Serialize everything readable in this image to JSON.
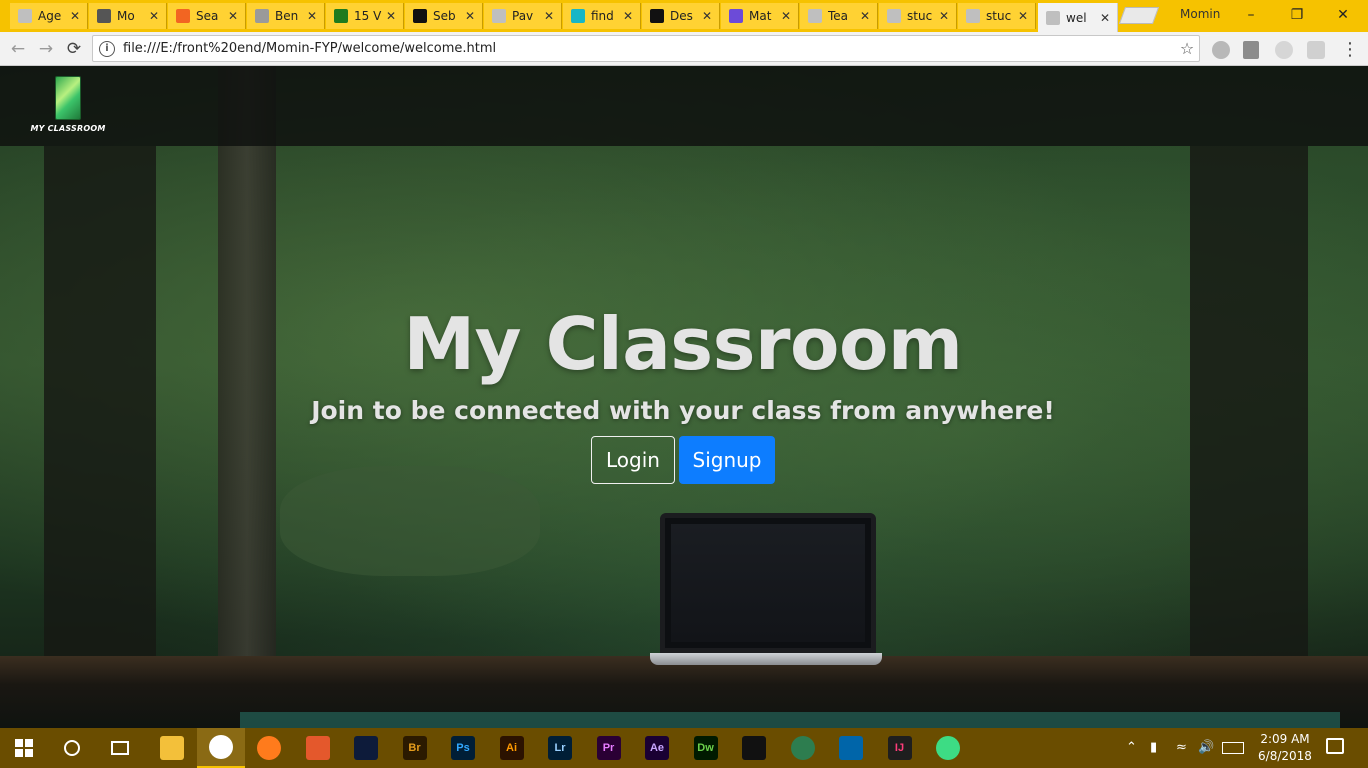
{
  "browser": {
    "tabs": [
      {
        "title": "Age",
        "favicon_color": "#bfbfbf",
        "icon": "page-icon"
      },
      {
        "title": "Mo",
        "favicon_color": "#555555",
        "icon": "mo-icon"
      },
      {
        "title": "Sea",
        "favicon_color": "#f26522",
        "icon": "soundcloud-icon"
      },
      {
        "title": "Ben",
        "favicon_color": "#9a9a9a",
        "icon": "page-icon"
      },
      {
        "title": "15 V",
        "favicon_color": "#1e7b1e",
        "icon": "upwork-icon"
      },
      {
        "title": "Seb",
        "favicon_color": "#111111",
        "icon": "seb-icon"
      },
      {
        "title": "Pav",
        "favicon_color": "#bfbfbf",
        "icon": "page-icon"
      },
      {
        "title": "find",
        "favicon_color": "#17b6c6",
        "icon": "find-icon"
      },
      {
        "title": "Des",
        "favicon_color": "#111111",
        "icon": "ad-icon"
      },
      {
        "title": "Mat",
        "favicon_color": "#6c4bd8",
        "icon": "mat-icon"
      },
      {
        "title": "Tea",
        "favicon_color": "#bfbfbf",
        "icon": "page-icon"
      },
      {
        "title": "stuc",
        "favicon_color": "#bfbfbf",
        "icon": "page-icon"
      },
      {
        "title": "stuc",
        "favicon_color": "#bfbfbf",
        "icon": "page-icon"
      },
      {
        "title": "wel",
        "favicon_color": "#bfbfbf",
        "icon": "page-icon",
        "active": true
      }
    ],
    "profile_name": "Momin",
    "url": "file:///E:/front%20end/Momin-FYP/welcome/welcome.html"
  },
  "page": {
    "logo_caption": "MY CLASSROOM",
    "hero_title": "My Classroom",
    "hero_subtitle": "Join to be connected with your class from anywhere!",
    "login_label": "Login",
    "signup_label": "Signup",
    "accent_color": "#0d7dff"
  },
  "taskbar": {
    "apps": [
      "File Explorer",
      "Chrome",
      "Firefox",
      "MATLAB",
      "Visual Studio",
      "Bridge",
      "Photoshop",
      "Illustrator",
      "Lightroom",
      "Premiere",
      "After Effects",
      "Dreamweaver",
      "Unity",
      "Atom",
      "VS Code",
      "IntelliJ",
      "Android Studio"
    ],
    "app_short_labels": [
      "",
      "",
      "",
      "",
      "",
      "Br",
      "Ps",
      "Ai",
      "Lr",
      "Pr",
      "Ae",
      "Dw",
      "",
      "",
      "",
      "IJ",
      ""
    ],
    "time": "2:09 AM",
    "date": "6/8/2018"
  }
}
